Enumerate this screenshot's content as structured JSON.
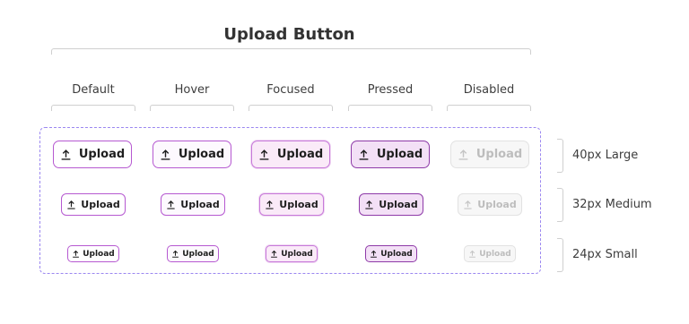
{
  "title": "Upload Button",
  "states": [
    "Default",
    "Hover",
    "Focused",
    "Pressed",
    "Disabled"
  ],
  "sizes": [
    "40px Large",
    "32px Medium",
    "24px Small"
  ],
  "button": {
    "label": "Upload",
    "icon": "upload-arrow-icon"
  },
  "colors": {
    "accent": "#b659d1",
    "frame": "#9b87f0",
    "disabled": "#bdbdbd"
  }
}
